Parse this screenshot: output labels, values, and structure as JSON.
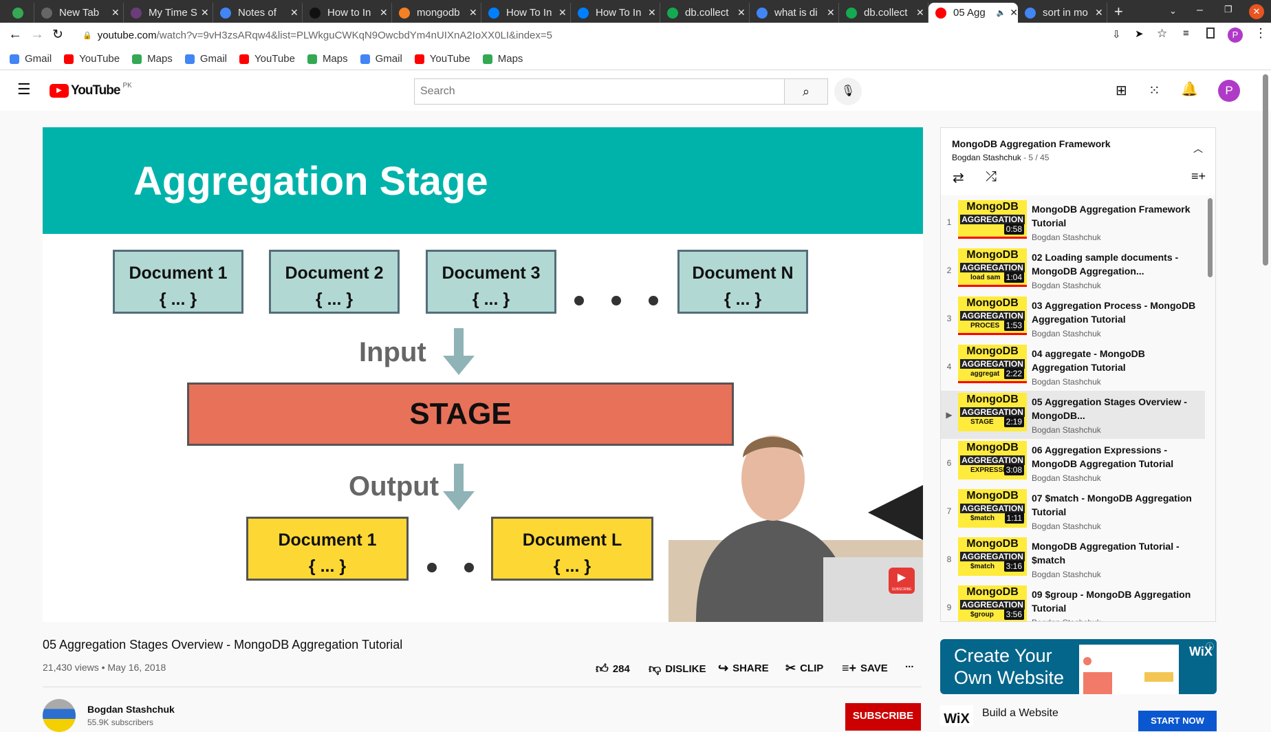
{
  "browser": {
    "tabs": [
      {
        "title": "",
        "color": "#34a853"
      },
      {
        "title": "New Tab",
        "color": "#666"
      },
      {
        "title": "My Time S",
        "color": "#6a3d7a"
      },
      {
        "title": "Notes of",
        "color": "#4285f4"
      },
      {
        "title": "How to In",
        "color": "#111"
      },
      {
        "title": "mongodb",
        "color": "#f48024"
      },
      {
        "title": "How To In",
        "color": "#0080ff"
      },
      {
        "title": "How To In",
        "color": "#0080ff"
      },
      {
        "title": "db.collect",
        "color": "#13aa52"
      },
      {
        "title": "what is di",
        "color": "#4285f4"
      },
      {
        "title": "db.collect",
        "color": "#13aa52"
      },
      {
        "title": "05 Agg",
        "color": "#ff0000",
        "active": true
      },
      {
        "title": "sort in mo",
        "color": "#4285f4"
      }
    ],
    "url_domain": "youtube.com",
    "url_path": "/watch?v=9vH3zsARqw4&list=PLWkguCWKqN9OwcbdYm4nUIXnA2IoXX0LI&index=5",
    "profile_initial": "P",
    "bookmarks": [
      {
        "label": "Gmail",
        "color": "#4285f4"
      },
      {
        "label": "YouTube",
        "color": "#ff0000"
      },
      {
        "label": "Maps",
        "color": "#34a853"
      },
      {
        "label": "Gmail",
        "color": "#4285f4"
      },
      {
        "label": "YouTube",
        "color": "#ff0000"
      },
      {
        "label": "Maps",
        "color": "#34a853"
      },
      {
        "label": "Gmail",
        "color": "#4285f4"
      },
      {
        "label": "YouTube",
        "color": "#ff0000"
      },
      {
        "label": "Maps",
        "color": "#34a853"
      }
    ]
  },
  "header": {
    "logo": "YouTube",
    "region": "PK",
    "search_placeholder": "Search",
    "avatar": "P"
  },
  "slide": {
    "title": "Aggregation Stage",
    "inputs": [
      "Document 1",
      "Document 2",
      "Document 3",
      "Document N"
    ],
    "body": "{ ... }",
    "input_label": "Input",
    "stage": "STAGE",
    "output_label": "Output",
    "outputs": [
      "Document 1",
      "Document L"
    ],
    "subscribe_badge": "SUBSCRIBE"
  },
  "video": {
    "title": "05 Aggregation Stages Overview - MongoDB Aggregation Tutorial",
    "meta": "21,430 views • May 16, 2018",
    "likes": "284",
    "dislike": "DISLIKE",
    "share": "SHARE",
    "clip": "CLIP",
    "save": "SAVE",
    "more": "...",
    "channel": "Bogdan Stashchuk",
    "subscribers": "55.9K subscribers",
    "subscribe": "SUBSCRIBE"
  },
  "playlist": {
    "title": "MongoDB Aggregation Framework",
    "owner": "Bogdan Stashchuk",
    "position": "- 5 / 45",
    "items": [
      {
        "num": "1",
        "title": "MongoDB Aggregation Framework Tutorial",
        "channel": "Bogdan Stashchuk",
        "duration": "0:58",
        "sub": "",
        "watched": true
      },
      {
        "num": "2",
        "title": "02 Loading sample documents - MongoDB Aggregation...",
        "channel": "Bogdan Stashchuk",
        "duration": "1:04",
        "sub": "load sam",
        "watched": true
      },
      {
        "num": "3",
        "title": "03 Aggregation Process - MongoDB Aggregation Tutorial",
        "channel": "Bogdan Stashchuk",
        "duration": "1:53",
        "sub": "PROCES",
        "watched": true
      },
      {
        "num": "4",
        "title": "04 aggregate - MongoDB Aggregation Tutorial",
        "channel": "Bogdan Stashchuk",
        "duration": "2:22",
        "sub": "aggregat",
        "watched": true
      },
      {
        "num": "▶",
        "title": "05 Aggregation Stages Overview - MongoDB...",
        "channel": "Bogdan Stashchuk",
        "duration": "2:19",
        "sub": "STAGE",
        "current": true
      },
      {
        "num": "6",
        "title": "06 Aggregation Expressions - MongoDB Aggregation Tutorial",
        "channel": "Bogdan Stashchuk",
        "duration": "3:08",
        "sub": "EXPRESSI"
      },
      {
        "num": "7",
        "title": "07 $match - MongoDB Aggregation Tutorial",
        "channel": "Bogdan Stashchuk",
        "duration": "1:11",
        "sub": "$match"
      },
      {
        "num": "8",
        "title": "MongoDB Aggregation Tutorial - $match",
        "channel": "Bogdan Stashchuk",
        "duration": "3:16",
        "sub": "$match"
      },
      {
        "num": "9",
        "title": "09 $group - MongoDB Aggregation Tutorial",
        "channel": "Bogdan Stashchuk",
        "duration": "3:56",
        "sub": "$group"
      }
    ],
    "thumb_brand": "MongoDB",
    "thumb_tag": "AGGREGATION"
  },
  "ad": {
    "headline_1": "Create Your",
    "headline_2": "Own Website",
    "brand": "WiX",
    "title": "Build a Website",
    "cta": "START NOW"
  }
}
